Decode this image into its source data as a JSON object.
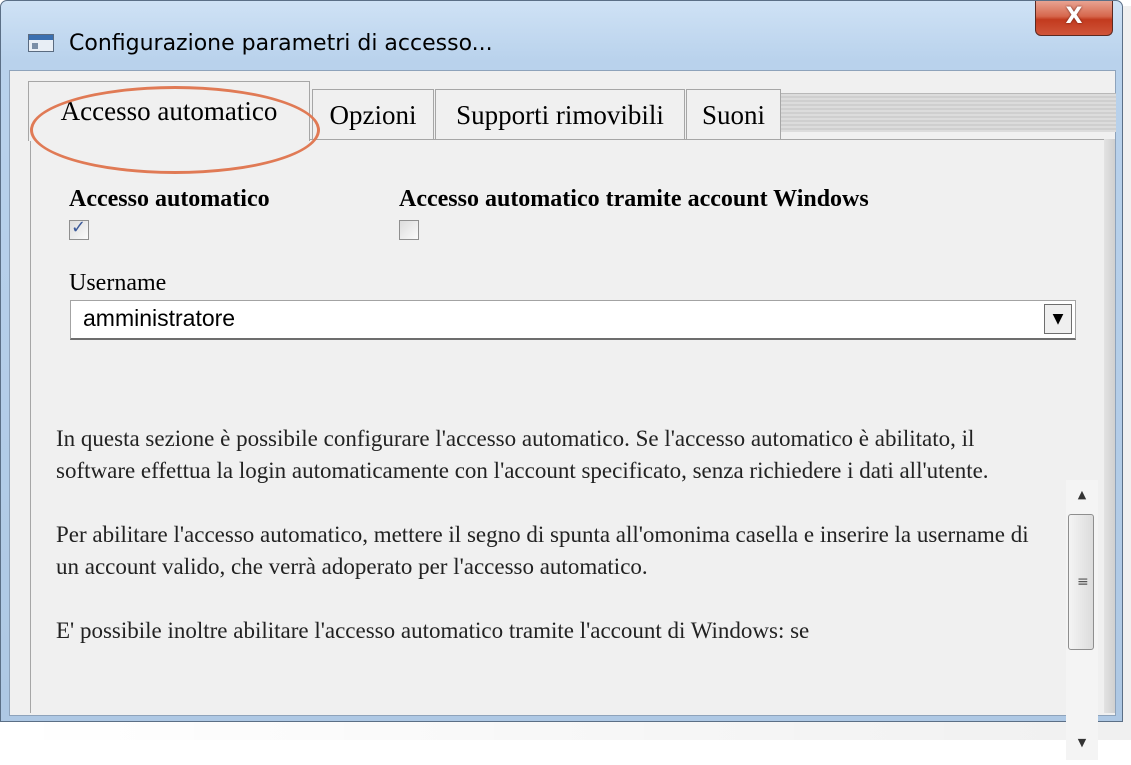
{
  "window": {
    "title": "Configurazione parametri di accesso...",
    "close_glyph": "X"
  },
  "tabs": [
    {
      "label": "Accesso automatico",
      "active": true
    },
    {
      "label": "Opzioni",
      "active": false
    },
    {
      "label": "Supporti rimovibili",
      "active": false
    },
    {
      "label": "Suoni",
      "active": false
    }
  ],
  "form": {
    "auto_access_label": "Accesso automatico",
    "auto_access_checked": true,
    "windows_account_label": "Accesso automatico tramite account Windows",
    "windows_account_checked": false,
    "username_label": "Username",
    "username_value": "amministratore",
    "dropdown_glyph": "▼"
  },
  "description": {
    "paragraphs": [
      "In questa sezione è possibile configurare l'accesso automatico. Se l'accesso automatico è abilitato, il software effettua la login automaticamente con l'account specificato, senza richiedere i dati all'utente.",
      "Per abilitare l'accesso automatico, mettere il segno di spunta all'omonima casella e inserire la username di un account valido, che verrà adoperato per l'accesso automatico.",
      "E' possibile inoltre abilitare l'accesso automatico tramite l'account di Windows: se"
    ]
  },
  "scrollbar": {
    "up_glyph": "▲",
    "down_glyph": "▼",
    "grip_glyph": "≡"
  },
  "colors": {
    "close_button": "#c94a30",
    "highlight_ellipse": "#e07a55",
    "checkbox_mark": "#3c5a9a"
  }
}
